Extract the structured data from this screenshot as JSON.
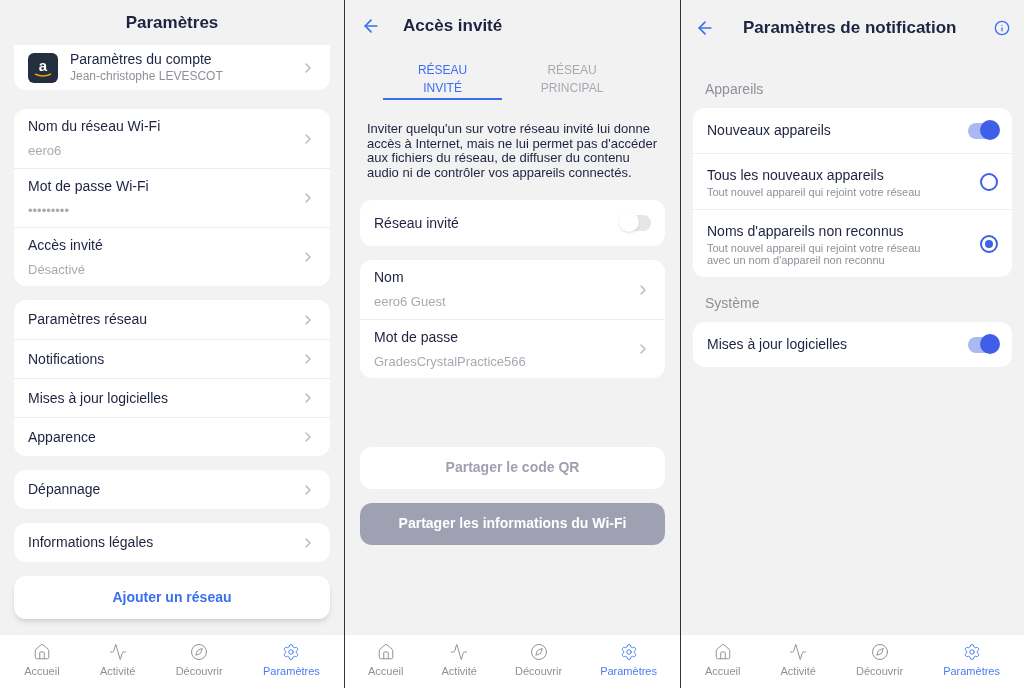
{
  "settings_screen": {
    "title": "Paramètres",
    "account": {
      "logo": "a",
      "label": "Paramètres du compte",
      "sub": "Jean-christophe LEVESCOT"
    },
    "groups": [
      [
        {
          "label": "Nom du réseau Wi-Fi",
          "sub": "eero6"
        },
        {
          "label": "Mot de passe Wi-Fi",
          "sub": "•••••••••"
        },
        {
          "label": "Accès invité",
          "sub": "Désactivé"
        }
      ],
      [
        {
          "label": "Paramètres réseau"
        },
        {
          "label": "Notifications"
        },
        {
          "label": "Mises à jour logicielles"
        },
        {
          "label": "Apparence"
        }
      ],
      [
        {
          "label": "Dépannage"
        }
      ],
      [
        {
          "label": "Informations légales"
        }
      ]
    ],
    "action": "Ajouter un réseau",
    "tab_bar": [
      {
        "kind": "home",
        "label": "Accueil",
        "selected": false
      },
      {
        "kind": "activity",
        "label": "Activité",
        "selected": false
      },
      {
        "kind": "discover",
        "label": "Découvrir",
        "selected": false
      },
      {
        "kind": "settings",
        "label": "Paramètres",
        "selected": true
      }
    ]
  },
  "guest_screen": {
    "title": "Accès invité",
    "tabs": [
      {
        "label": "RÉSEAU INVITÉ",
        "selected": true
      },
      {
        "label": "RÉSEAU PRINCIPAL",
        "selected": false
      }
    ],
    "description": "Inviter quelqu'un sur votre réseau invité lui donne accès à Internet, mais ne lui permet pas d'accéder aux fichiers du réseau, de diffuser du contenu audio ni de contrôler vos appareils connectés.",
    "toggle": {
      "label": "Réseau invité",
      "on": false
    },
    "rows": [
      {
        "label": "Nom",
        "sub": "eero6 Guest"
      },
      {
        "label": "Mot de passe",
        "sub": "GradesCrystalPractice566"
      }
    ],
    "buttons": [
      {
        "label": "Partager le code QR",
        "kind": "secondary"
      },
      {
        "label": "Partager les informations du Wi-Fi",
        "kind": "primary"
      }
    ],
    "tab_bar": [
      {
        "kind": "home",
        "label": "Accueil",
        "selected": false
      },
      {
        "kind": "activity",
        "label": "Activité",
        "selected": false
      },
      {
        "kind": "discover",
        "label": "Découvrir",
        "selected": false
      },
      {
        "kind": "settings",
        "label": "Paramètres",
        "selected": true
      }
    ]
  },
  "notification_screen": {
    "title": "Paramètres de notification",
    "sections": [
      {
        "heading": "Appareils",
        "rows": [
          {
            "kind": "toggle",
            "label": "Nouveaux appareils",
            "on": true
          },
          {
            "kind": "radio",
            "label": "Tous les nouveaux appareils",
            "sub": "Tout nouvel appareil qui rejoint votre réseau",
            "selected": false
          },
          {
            "kind": "radio",
            "label": "Noms d'appareils non reconnus",
            "sub": "Tout nouvel appareil qui rejoint votre réseau avec un nom d'appareil non reconnu",
            "selected": true
          }
        ]
      },
      {
        "heading": "Système",
        "rows": [
          {
            "kind": "toggle",
            "label": "Mises à jour logicielles",
            "on": true
          }
        ]
      }
    ],
    "tab_bar": [
      {
        "kind": "home",
        "label": "Accueil",
        "selected": false
      },
      {
        "kind": "activity",
        "label": "Activité",
        "selected": false
      },
      {
        "kind": "discover",
        "label": "Découvrir",
        "selected": false
      },
      {
        "kind": "settings",
        "label": "Paramètres",
        "selected": true
      }
    ]
  }
}
